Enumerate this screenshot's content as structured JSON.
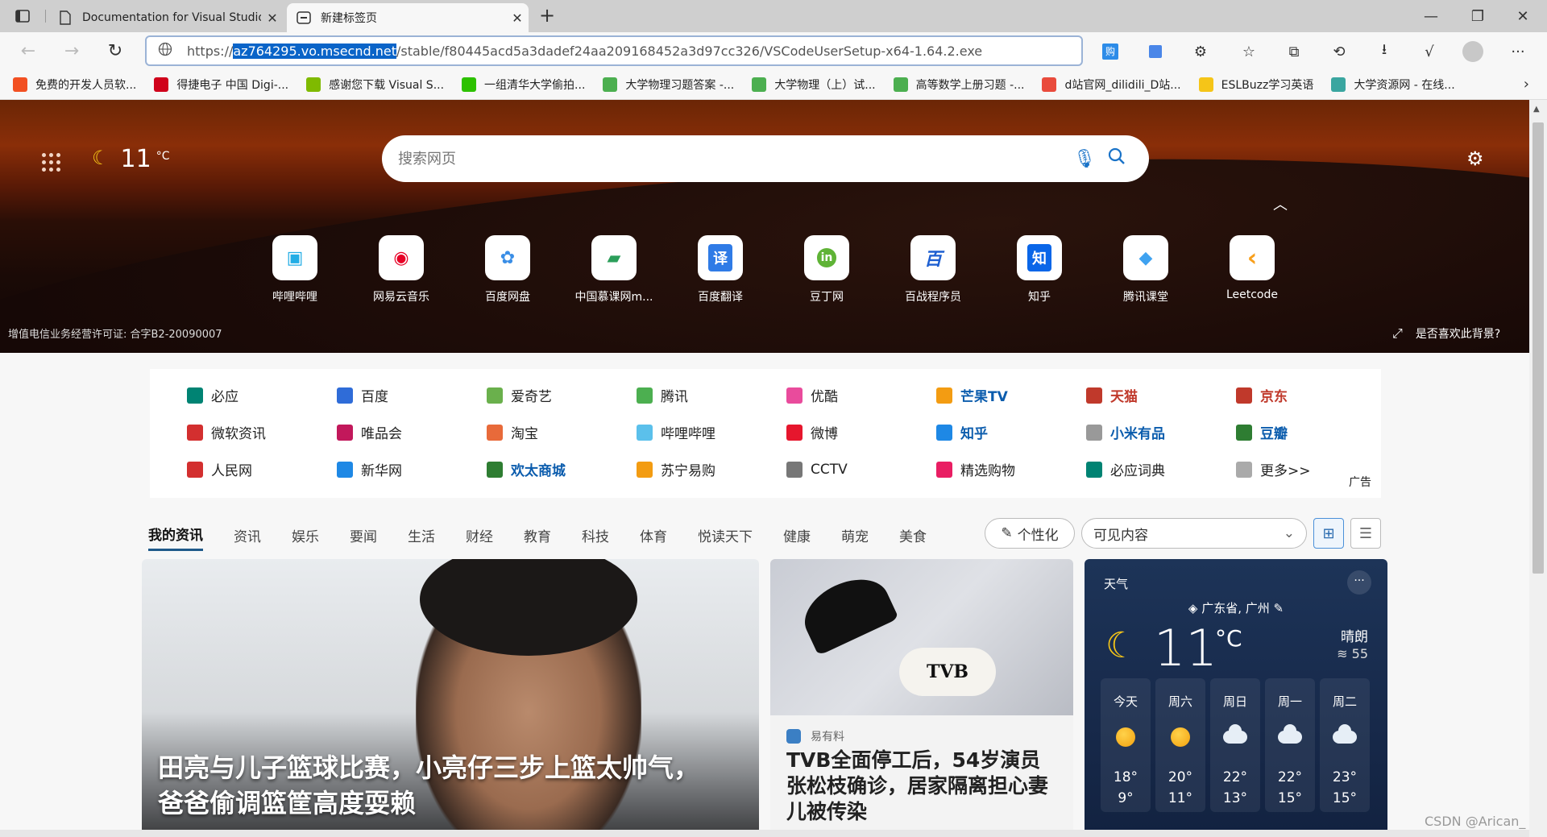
{
  "browser": {
    "tabs": [
      {
        "title": "Documentation for Visual Studio",
        "active": false
      },
      {
        "title": "新建标签页",
        "active": true
      }
    ],
    "new_tab": "+",
    "window": {
      "minimize": "—",
      "restore": "❐",
      "close": "✕"
    },
    "address": {
      "prefix": "https://",
      "selected": "az764295.vo.msecnd.net",
      "suffix": "/stable/f80445acd5a3dadef24aa209168452a3d97cc326/VSCodeUserSetup-x64-1.64.2.exe"
    },
    "bookmarks": [
      {
        "label": "免费的开发人员软...",
        "color": "#f25022"
      },
      {
        "label": "得捷电子 中国 Digi-...",
        "color": "#d0021b"
      },
      {
        "label": "感谢您下载 Visual S...",
        "color": "#7fba00"
      },
      {
        "label": "一组清华大学偷拍...",
        "color": "#2dc100"
      },
      {
        "label": "大学物理习题答案 -...",
        "color": "#4caf50"
      },
      {
        "label": "大学物理（上）试...",
        "color": "#4caf50"
      },
      {
        "label": "高等数学上册习题 -...",
        "color": "#4caf50"
      },
      {
        "label": "d站官网_dilidili_D站...",
        "color": "#e94b3c"
      },
      {
        "label": "ESLBuzz学习英语",
        "color": "#f5c518"
      },
      {
        "label": "大学资源网 - 在线...",
        "color": "#3aa6a0"
      }
    ]
  },
  "hero": {
    "temperature": "11",
    "unit": "°C",
    "search_placeholder": "搜索网页",
    "quick_links": [
      {
        "label": "哔哩哔哩",
        "glyph": "▣",
        "color": "#23ade5"
      },
      {
        "label": "网易云音乐",
        "glyph": "◉",
        "color": "#e60026"
      },
      {
        "label": "百度网盘",
        "glyph": "✿",
        "color": "#3a8ee6"
      },
      {
        "label": "中国慕课网m...",
        "glyph": "▰",
        "color": "#2b9e5a"
      },
      {
        "label": "百度翻译",
        "glyph": "译",
        "color": "#2f7be6"
      },
      {
        "label": "豆丁网",
        "glyph": "in",
        "color": "#5fb336"
      },
      {
        "label": "百战程序员",
        "glyph": "百",
        "color": "#1e5fd1"
      },
      {
        "label": "知乎",
        "glyph": "知",
        "color": "#0a66e8"
      },
      {
        "label": "腾讯课堂",
        "glyph": "◆",
        "color": "#3fa2f0"
      },
      {
        "label": "Leetcode",
        "glyph": "‹",
        "color": "#f89f1b"
      }
    ],
    "license": "增值电信业务经营许可证: 合字B2-20090007",
    "like_background": "是否喜欢此背景?"
  },
  "links": {
    "rows": [
      [
        {
          "label": "必应",
          "color": "#008373",
          "style": "normal"
        },
        {
          "label": "百度",
          "color": "#2f6cd8",
          "style": "normal"
        },
        {
          "label": "爱奇艺",
          "color": "#6ab04c",
          "style": "normal"
        },
        {
          "label": "腾讯",
          "color": "#4caf50",
          "style": "normal"
        },
        {
          "label": "优酷",
          "color": "#e94b9c",
          "style": "normal"
        },
        {
          "label": "芒果TV",
          "color": "#f39c12",
          "style": "blue"
        },
        {
          "label": "天猫",
          "color": "#c0392b",
          "style": "red"
        },
        {
          "label": "京东",
          "color": "#c0392b",
          "style": "red"
        }
      ],
      [
        {
          "label": "微软资讯",
          "color": "#d32f2f",
          "style": "normal"
        },
        {
          "label": "唯品会",
          "color": "#c2185b",
          "style": "normal"
        },
        {
          "label": "淘宝",
          "color": "#e86a3a",
          "style": "normal"
        },
        {
          "label": "哔哩哔哩",
          "color": "#5bc0eb",
          "style": "normal"
        },
        {
          "label": "微博",
          "color": "#e6162d",
          "style": "normal"
        },
        {
          "label": "知乎",
          "color": "#1e88e5",
          "style": "blue"
        },
        {
          "label": "小米有品",
          "color": "#999999",
          "style": "blue"
        },
        {
          "label": "豆瓣",
          "color": "#2e7d32",
          "style": "blue"
        }
      ],
      [
        {
          "label": "人民网",
          "color": "#d32f2f",
          "style": "normal"
        },
        {
          "label": "新华网",
          "color": "#1e88e5",
          "style": "normal"
        },
        {
          "label": "欢太商城",
          "color": "#2e7d32",
          "style": "blue"
        },
        {
          "label": "苏宁易购",
          "color": "#f39c12",
          "style": "normal"
        },
        {
          "label": "CCTV",
          "color": "#777777",
          "style": "normal"
        },
        {
          "label": "精选购物",
          "color": "#e91e63",
          "style": "normal"
        },
        {
          "label": "必应词典",
          "color": "#008373",
          "style": "normal"
        },
        {
          "label": "更多>>",
          "color": "#aaaaaa",
          "style": "normal"
        }
      ]
    ],
    "ad_label": "广告"
  },
  "feed": {
    "tabs": [
      "我的资讯",
      "资讯",
      "娱乐",
      "要闻",
      "生活",
      "财经",
      "教育",
      "科技",
      "体育",
      "悦读天下",
      "健康",
      "萌宠",
      "美食"
    ],
    "active_tab": 0,
    "personalize": "个性化",
    "visible_content": "可见内容",
    "main_card": {
      "headline": "田亮与儿子篮球比赛，小亮仔三步上篮太帅气，爸爸偷调篮筐高度耍赖"
    },
    "tvb_card": {
      "source": "易有料",
      "logo": "TVB",
      "headline": "TVB全面停工后，54岁演员张松枝确诊，居家隔离担心妻儿被传染"
    },
    "weather": {
      "title": "天气",
      "location": "广东省, 广州",
      "temperature": "11",
      "unit": "°C",
      "condition": "晴朗",
      "aqi": "55",
      "forecast": [
        {
          "day": "今天",
          "icon": "sun",
          "high": "18°",
          "low": "9°"
        },
        {
          "day": "周六",
          "icon": "sun",
          "high": "20°",
          "low": "11°"
        },
        {
          "day": "周日",
          "icon": "cloud",
          "high": "22°",
          "low": "13°"
        },
        {
          "day": "周一",
          "icon": "cloud",
          "high": "22°",
          "low": "15°"
        },
        {
          "day": "周二",
          "icon": "cloud",
          "high": "23°",
          "low": "15°"
        }
      ]
    }
  },
  "watermark": "CSDN @Arican_"
}
